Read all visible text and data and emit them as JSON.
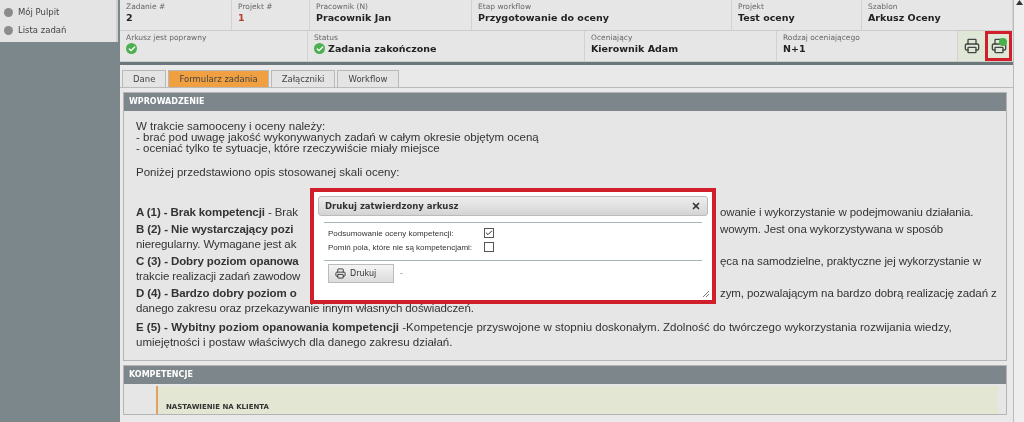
{
  "sidebar": {
    "items": [
      {
        "label": "Mój Pulpit"
      },
      {
        "label": "Lista zadań"
      }
    ]
  },
  "header": {
    "row_1": [
      {
        "label": "Zadanie #",
        "value": "2",
        "accent": false
      },
      {
        "label": "Projekt #",
        "value": "1",
        "accent": true
      },
      {
        "label": "Pracownik (N)",
        "value": "Pracownik Jan",
        "accent": false
      },
      {
        "label": "Etap workflow",
        "value": "Przygotowanie do oceny",
        "accent": false
      },
      {
        "label": "Projekt",
        "value": "Test oceny",
        "accent": false
      },
      {
        "label": "Szablon",
        "value": "Arkusz Oceny",
        "accent": false
      }
    ],
    "row_2": [
      {
        "kind": "check",
        "label": "Arkusz jest poprawny"
      },
      {
        "kind": "check_text",
        "label": "Status",
        "value": "Zadania zakończone"
      },
      {
        "kind": "text",
        "label": "Oceniający",
        "value": "Kierownik Adam"
      },
      {
        "kind": "text",
        "label": "Rodzaj oceniającego",
        "value": "N+1"
      }
    ],
    "buttons": [
      {
        "kind": "print",
        "highlighted": false
      },
      {
        "kind": "print_approved",
        "highlighted": true
      }
    ]
  },
  "tabs": [
    {
      "label": "Dane",
      "selected": false
    },
    {
      "label": "Formularz zadania",
      "selected": true
    },
    {
      "label": "Załączniki",
      "selected": false
    },
    {
      "label": "Workflow",
      "selected": false
    }
  ],
  "intro": {
    "title": "WPROWADZENIE",
    "paragraphs": [
      "W trakcie samooceny i oceny należy:\n- brać pod uwagę jakość wykonywanych zadań w całym okresie objętym oceną\n- oceniać tylko te sytuacje, które rzeczywiście miały miejsce",
      "Poniżej przedstawiono opis stosowanej skali oceny:"
    ],
    "scale": [
      {
        "left": "**A (1) - Brak kompetencji** - Brak",
        "right": "owanie i wykorzystanie w podejmowaniu działania."
      },
      {
        "left": "**B (2) - Nie wystarczający pozi**",
        "right": "wowym. Jest ona wykorzystywana w sposób",
        "continuation": "nieregularny. Wymagane jest ak"
      },
      {
        "left": "**C (3) - Dobry poziom opanowa**",
        "right": "ęca na samodzielne, praktyczne jej wykorzystanie w",
        "continuation": "trakcie realizacji zadań zawodow"
      },
      {
        "left": "**D (4) - Bardzo dobry poziom o**",
        "right": "zym, pozwalającym na bardzo dobrą realizację  zadań z",
        "continuation": "danego zakresu oraz przekazywanie innym własnych doświadczeń."
      }
    ],
    "closing": "**E (5) - Wybitny poziom opanowania kompetencji** -Kompetencje przyswojone w stopniu doskonałym. Zdolność do twórczego wykorzystania rozwijania wiedzy, umiejętności i postaw właściwych dla danego zakresu działań."
  },
  "competences": {
    "title": "KOMPETENCJE",
    "items": [
      {
        "label": "NASTAWIENIE NA KLIENTA"
      }
    ]
  },
  "dialog": {
    "title": "Drukuj zatwierdzony arkusz",
    "highlighted": true,
    "options": [
      {
        "label": "Podsumowanie oceny kompetencji:",
        "checked": true
      },
      {
        "label": "Pomiń pola, które nie są kompetencjami:",
        "checked": false
      }
    ],
    "button": "Drukuj",
    "note": "-"
  }
}
